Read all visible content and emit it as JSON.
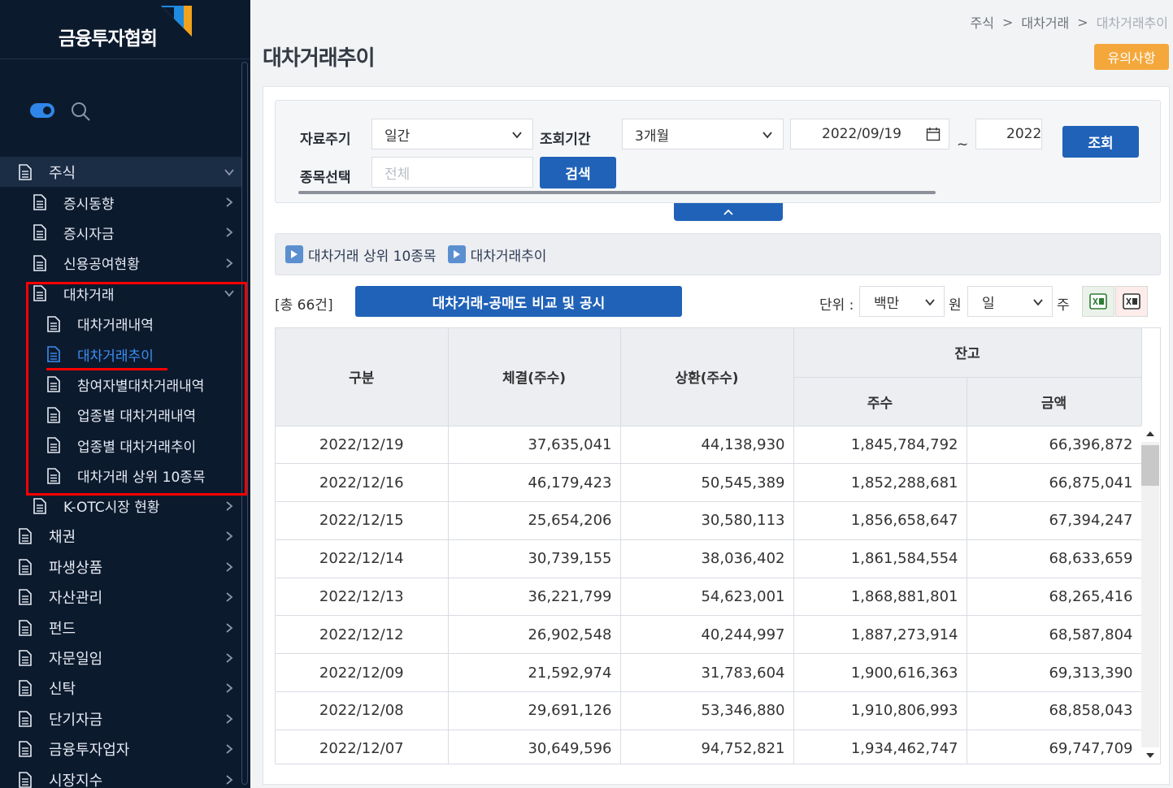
{
  "logo": {
    "text": "금융투자협회"
  },
  "sidebar": {
    "items": [
      {
        "label": "주식",
        "level": 1,
        "open": true
      },
      {
        "label": "증시동향",
        "level": 2
      },
      {
        "label": "증시자금",
        "level": 2
      },
      {
        "label": "신용공여현황",
        "level": 2
      },
      {
        "label": "대차거래",
        "level": 2,
        "open": true
      },
      {
        "label": "대차거래내역",
        "level": 3
      },
      {
        "label": "대차거래추이",
        "level": 3,
        "active": true
      },
      {
        "label": "참여자별대차거래내역",
        "level": 3
      },
      {
        "label": "업종별 대차거래내역",
        "level": 3
      },
      {
        "label": "업종별 대차거래추이",
        "level": 3
      },
      {
        "label": "대차거래 상위 10종목",
        "level": 3
      },
      {
        "label": "K-OTC시장 현황",
        "level": 2
      },
      {
        "label": "채권",
        "level": 1
      },
      {
        "label": "파생상품",
        "level": 1
      },
      {
        "label": "자산관리",
        "level": 1
      },
      {
        "label": "펀드",
        "level": 1
      },
      {
        "label": "자문일임",
        "level": 1
      },
      {
        "label": "신탁",
        "level": 1
      },
      {
        "label": "단기자금",
        "level": 1
      },
      {
        "label": "금융투자업자",
        "level": 1
      },
      {
        "label": "시장지수",
        "level": 1
      }
    ]
  },
  "breadcrumb": [
    "주식",
    ">",
    "대차거래",
    ">",
    "대차거래추이"
  ],
  "page": {
    "title": "대차거래추이",
    "notice_button": "유의사항"
  },
  "filter": {
    "period_label": "자료주기",
    "period_value": "일간",
    "range_label": "조회기간",
    "range_value": "3개월",
    "date_from": "2022/09/19",
    "tilde": "~",
    "date_to": "2022",
    "stock_label": "종목선택",
    "stock_placeholder": "전체",
    "search_button": "검색",
    "query_button": "조회"
  },
  "tabs": [
    "대차거래 상위 10종목",
    "대차거래추이"
  ],
  "toolbar": {
    "total": "[총 66건]",
    "compare_button": "대차거래-공매도 비교 및 공시",
    "unit_label": "단위 :",
    "unit_amount": "백만",
    "unit_won": "원",
    "unit_shares_select": "일",
    "unit_shares": "주"
  },
  "table": {
    "headers": {
      "category": "구분",
      "executed": "체결(주수)",
      "repaid": "상환(주수)",
      "balance": "잔고",
      "balance_shares": "주수",
      "balance_amount": "금액"
    },
    "rows": [
      [
        "2022/12/19",
        "37,635,041",
        "44,138,930",
        "1,845,784,792",
        "66,396,872"
      ],
      [
        "2022/12/16",
        "46,179,423",
        "50,545,389",
        "1,852,288,681",
        "66,875,041"
      ],
      [
        "2022/12/15",
        "25,654,206",
        "30,580,113",
        "1,856,658,647",
        "67,394,247"
      ],
      [
        "2022/12/14",
        "30,739,155",
        "38,036,402",
        "1,861,584,554",
        "68,633,659"
      ],
      [
        "2022/12/13",
        "36,221,799",
        "54,623,001",
        "1,868,881,801",
        "68,265,416"
      ],
      [
        "2022/12/12",
        "26,902,548",
        "40,244,997",
        "1,887,273,914",
        "68,587,804"
      ],
      [
        "2022/12/09",
        "21,592,974",
        "31,783,604",
        "1,900,616,363",
        "69,313,390"
      ],
      [
        "2022/12/08",
        "29,691,126",
        "53,346,880",
        "1,910,806,993",
        "68,858,043"
      ],
      [
        "2022/12/07",
        "30,649,596",
        "94,752,821",
        "1,934,462,747",
        "69,747,709"
      ]
    ]
  },
  "colors": {
    "sidebar_bg": "#0c1a2e",
    "primary_blue": "#2062b8",
    "notice_orange": "#f4a83c",
    "highlight_red": "#ff0000",
    "active_link": "#3d8ef0"
  }
}
